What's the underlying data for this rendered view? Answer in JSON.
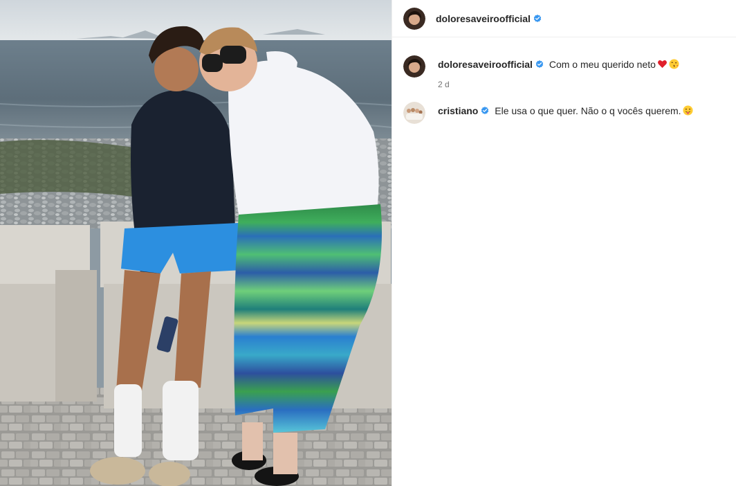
{
  "post": {
    "author": "doloresaveiroofficial",
    "verified": true,
    "photo_description_icon": "photo",
    "colors": {
      "verified_blue": "#3897f0",
      "username": "#262626",
      "meta": "#737373",
      "heart": "#ed4956"
    }
  },
  "caption": {
    "username": "doloresaveiroofficial",
    "text": "Com o meu querido neto",
    "emojis": [
      "red-heart",
      "winking-kiss-face"
    ],
    "time": "2 d"
  },
  "comments": [
    {
      "username": "cristiano",
      "text": "Ele usa o que quer. Não o q vocês querem.",
      "emojis": [
        "tongue-face"
      ]
    }
  ]
}
